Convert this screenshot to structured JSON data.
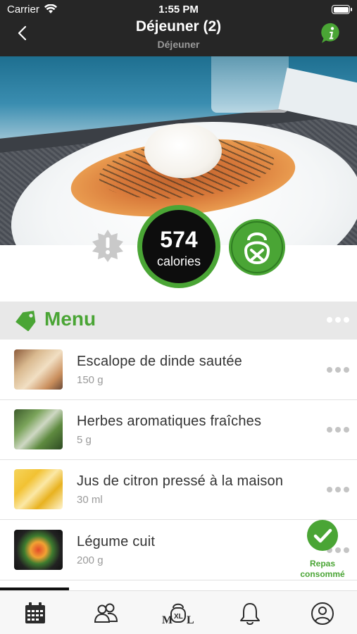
{
  "status_bar": {
    "carrier": "Carrier",
    "time": "1:55 PM"
  },
  "nav": {
    "title": "Déjeuner (2)",
    "subtitle": "Déjeuner",
    "back_icon": "chevron-left-icon",
    "info_icon": "info-bubble-icon"
  },
  "summary": {
    "calories_value": "574",
    "calories_label": "calories",
    "warning_icon": "warning-badge-icon",
    "activity_icon": "kettlebell-cross-icon"
  },
  "menu": {
    "title": "Menu",
    "tag_icon": "tag-icon",
    "items": [
      {
        "name": "Escalope de dinde sautée",
        "quantity": "150 g",
        "thumb": "turkey-escalope-photo"
      },
      {
        "name": "Herbes aromatiques fraîches",
        "quantity": "5 g",
        "thumb": "fresh-herbs-photo"
      },
      {
        "name": "Jus de citron pressé à la maison",
        "quantity": "30 ml",
        "thumb": "lemon-juice-photo"
      },
      {
        "name": "Légume cuit",
        "quantity": "200 g",
        "thumb": "cooked-vegetables-photo"
      }
    ]
  },
  "consumed": {
    "label_line1": "Repas",
    "label_line2": "consommé",
    "icon": "check-circle-icon"
  },
  "tab_bar": {
    "items": [
      "calendar-icon",
      "community-icon",
      "mxl-kettlebell-icon",
      "bell-icon",
      "profile-icon"
    ]
  },
  "colors": {
    "accent_green": "#4aa535",
    "nav_background": "#262626",
    "menu_header_background": "#e8e8e8"
  }
}
